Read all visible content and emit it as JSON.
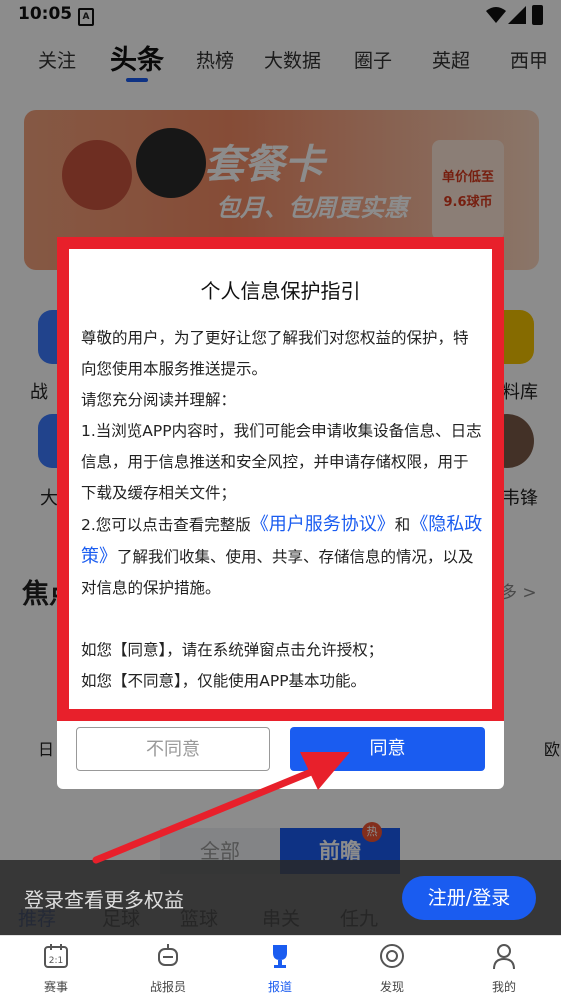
{
  "status_bar": {
    "time": "10:05",
    "sim_label": "A"
  },
  "top_tabs": [
    "关注",
    "头条",
    "热榜",
    "大数据",
    "圈子",
    "英超",
    "西甲"
  ],
  "banner": {
    "headline": "套餐卡",
    "subline": "包月、包周更实惠",
    "price_line1": "单价低至",
    "price_line2": "9.6球币"
  },
  "background": {
    "section_title": "焦点",
    "more": "多 >",
    "label_left_1": "战",
    "label_right_1": "料库",
    "label_left_2": "大",
    "label_right_2": "韦锋",
    "label_left_3": "日",
    "label_right_3": "欧",
    "hot_badge": "热"
  },
  "filter_tabs": {
    "all": "全部",
    "future": "前瞻",
    "hot": "热"
  },
  "sub_tabs": [
    "推荐",
    "足球",
    "篮球",
    "串关",
    "任九"
  ],
  "login_bar": {
    "text": "登录查看更多权益",
    "button": "注册/登录"
  },
  "bottom_nav": [
    {
      "label": "赛事",
      "icon": "calendar-icon"
    },
    {
      "label": "战报员",
      "icon": "robot-icon"
    },
    {
      "label": "报道",
      "icon": "trophy-icon"
    },
    {
      "label": "发现",
      "icon": "discover-icon"
    },
    {
      "label": "我的",
      "icon": "user-icon"
    }
  ],
  "modal": {
    "title": "个人信息保护指引",
    "p1": "尊敬的用户，为了更好让您了解我们对您权益的保护，特向您使用本服务推送提示。",
    "p2": "请您充分阅读并理解：",
    "p3": "1.当浏览APP内容时，我们可能会申请收集设备信息、日志信息，用于信息推送和安全风控，并申请存储权限，用于下载及缓存相关文件；",
    "p4_prefix": "2.您可以点击查看完整版",
    "link_agreement": "《用户服务协议》",
    "p4_and": "和",
    "link_privacy": "《隐私政策》",
    "p4_suffix": "了解我们收集、使用、共享、存储信息的情况，以及对信息的保护措施。",
    "p5": "如您【同意】，请在系统弹窗点击允许授权；",
    "p6": "如您【不同意】，仅能使用APP基本功能。",
    "disagree": "不同意",
    "agree": "同意"
  },
  "colors": {
    "accent": "#1a5cf0",
    "annotation": "#e8202b"
  }
}
